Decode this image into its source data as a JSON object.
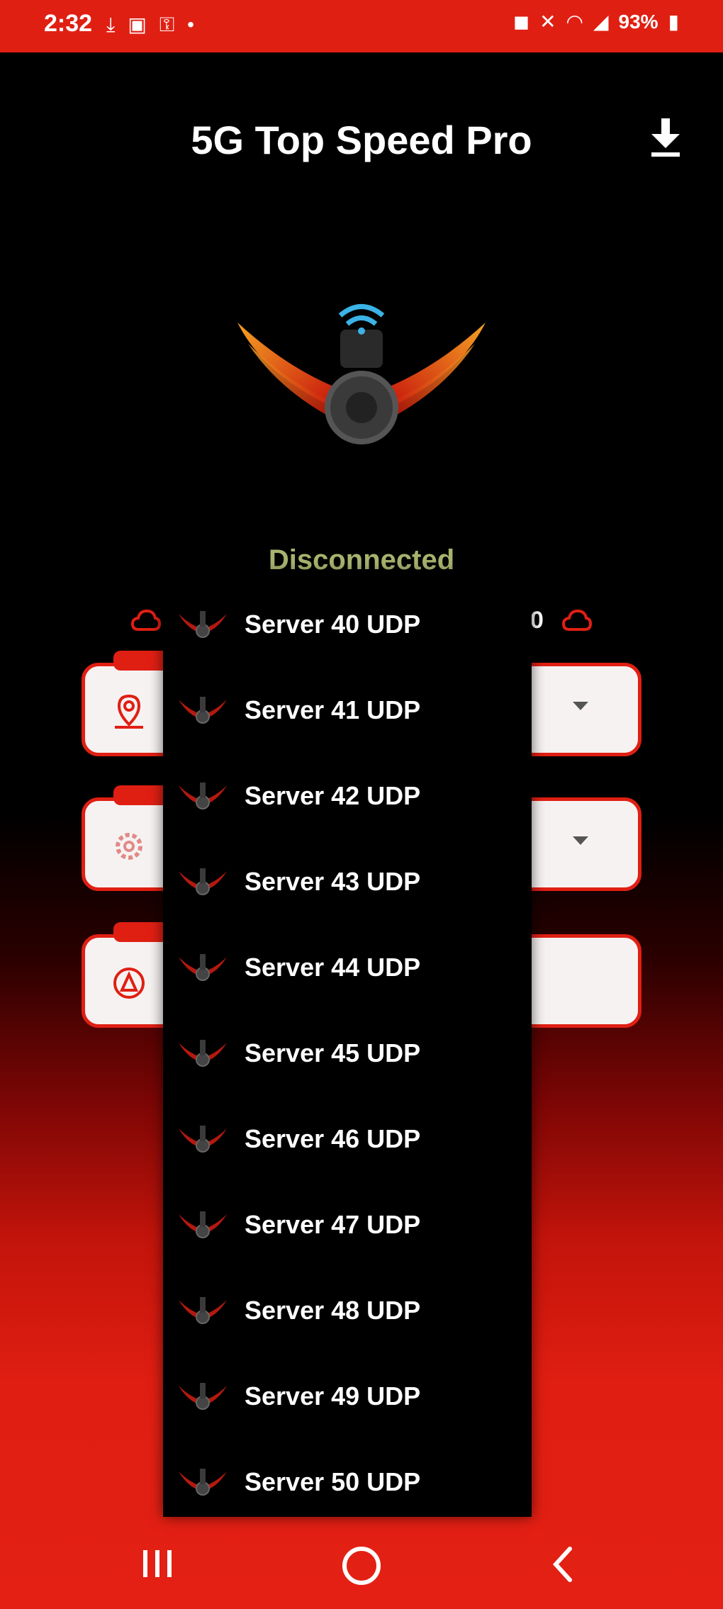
{
  "status_bar": {
    "time": "2:32",
    "battery": "93%"
  },
  "header": {
    "title": "5G Top Speed Pro"
  },
  "connection": {
    "status": "Disconnected",
    "status_color": "#a8b36e"
  },
  "speed_right": "0",
  "colors": {
    "accent": "#e01f13",
    "background": "#000000"
  },
  "server_list": [
    {
      "label": "Server 40 UDP"
    },
    {
      "label": "Server 41 UDP"
    },
    {
      "label": "Server 42 UDP"
    },
    {
      "label": "Server 43 UDP"
    },
    {
      "label": "Server 44 UDP"
    },
    {
      "label": "Server 45 UDP"
    },
    {
      "label": "Server 46 UDP"
    },
    {
      "label": "Server 47 UDP"
    },
    {
      "label": "Server 48 UDP"
    },
    {
      "label": "Server 49 UDP"
    },
    {
      "label": "Server 50 UDP"
    }
  ],
  "icons": {
    "download": "download-icon",
    "server": "wings-server-icon",
    "nav_recent": "recent-apps-icon",
    "nav_home": "home-icon",
    "nav_back": "back-icon"
  }
}
